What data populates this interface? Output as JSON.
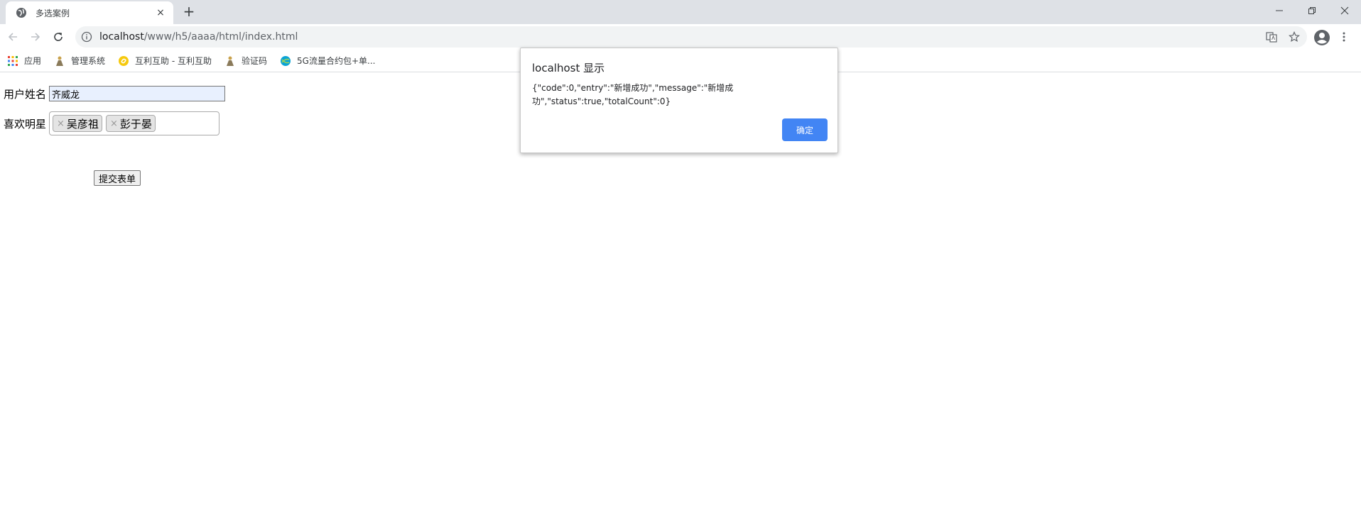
{
  "browser": {
    "tab_title": "多选案例",
    "tab_close": "×",
    "new_tab": "+",
    "url_host": "localhost",
    "url_path": "/www/h5/aaaa/html/index.html"
  },
  "bookmarks": [
    {
      "label": "应用",
      "icon": "apps-grid-icon"
    },
    {
      "label": "管理系统",
      "icon": "figure-icon"
    },
    {
      "label": "互利互助 - 互利互助",
      "icon": "yellow-circle-icon"
    },
    {
      "label": "验证码",
      "icon": "figure-icon"
    },
    {
      "label": "5G流量合约包+单...",
      "icon": "globe-leaf-icon"
    }
  ],
  "form": {
    "name_label": "用户姓名",
    "name_value": "齐威龙",
    "stars_label": "喜欢明星",
    "chips": [
      {
        "remove": "×",
        "label": "吴彦祖"
      },
      {
        "remove": "×",
        "label": "彭于晏"
      }
    ],
    "submit_label": "提交表单"
  },
  "dialog": {
    "title": "localhost 显示",
    "message": "{\"code\":0,\"entry\":\"新增成功\",\"message\":\"新增成功\",\"status\":true,\"totalCount\":0}",
    "ok_label": "确定"
  },
  "colors": {
    "tabstrip": "#dee1e6",
    "omnibox": "#f1f3f4",
    "dialog_button": "#4285f4",
    "input_autofill": "#e8f0fe"
  }
}
